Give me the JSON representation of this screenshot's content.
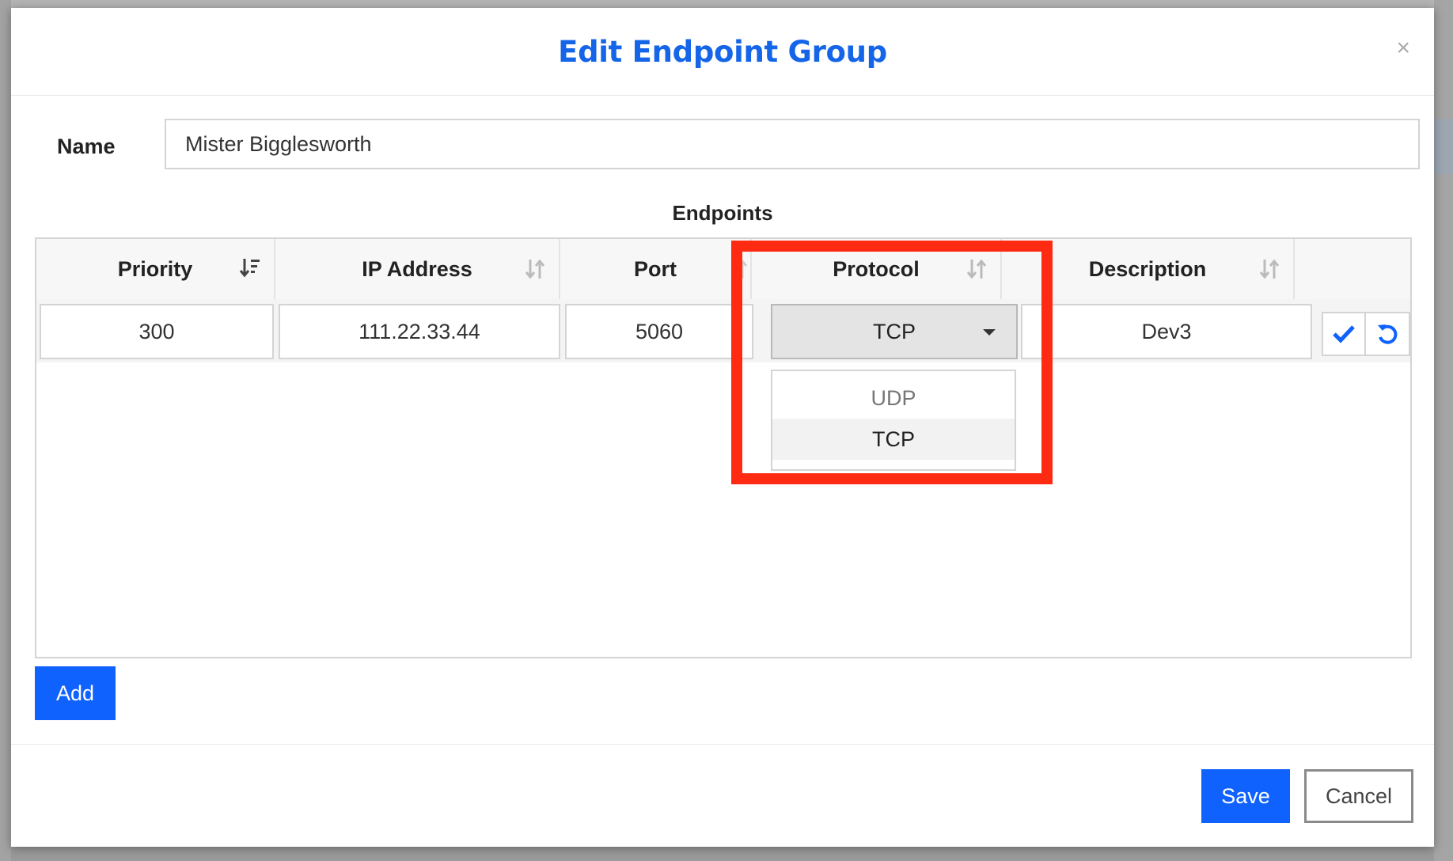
{
  "modal": {
    "title": "Edit Endpoint Group",
    "close_symbol": "×"
  },
  "name_field": {
    "label": "Name",
    "value": "Mister Bigglesworth"
  },
  "endpoints": {
    "title": "Endpoints",
    "columns": [
      {
        "label": "Priority",
        "sort_icon": "sort-descending-icon"
      },
      {
        "label": "IP Address",
        "sort_icon": "sort-icon"
      },
      {
        "label": "Port",
        "sort_icon": "sort-icon"
      },
      {
        "label": "Protocol",
        "sort_icon": "sort-icon"
      },
      {
        "label": "Description",
        "sort_icon": "sort-icon"
      }
    ],
    "editing_row": {
      "priority": "300",
      "ip_address": "111.22.33.44",
      "port": "5060",
      "protocol": "TCP",
      "description": "Dev3"
    },
    "protocol_options": [
      "UDP",
      "TCP"
    ],
    "row_actions": [
      "check-icon",
      "undo-icon"
    ]
  },
  "buttons": {
    "add": "Add",
    "save": "Save",
    "cancel": "Cancel"
  },
  "colors": {
    "accent": "#0f62fe",
    "title": "#1565e8",
    "highlight": "#ff2a12"
  }
}
